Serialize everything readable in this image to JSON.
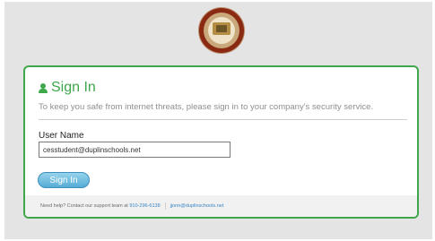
{
  "login": {
    "title": "Sign In",
    "description": "To keep you safe from internet threats, please sign in to your company's security service.",
    "username_label": "User Name",
    "username_value": "cesstudent@duplinschools.net",
    "sign_in_button": "Sign In"
  },
  "footer": {
    "help_text": "Need help? Contact our support team at",
    "phone": "910-296-6138",
    "email": "jjonn@duplinschools.net"
  },
  "colors": {
    "accent_green": "#3ea74a",
    "button_blue": "#56acd6",
    "link_blue": "#3a86c6"
  },
  "icons": {
    "title_icon": "user-icon",
    "logo": "school-seal-logo"
  }
}
